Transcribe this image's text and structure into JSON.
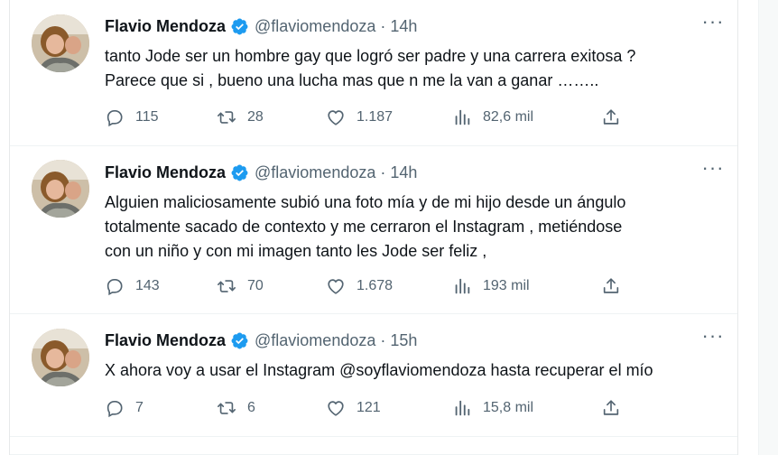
{
  "tweets": [
    {
      "name": "Flavio Mendoza",
      "handle": "@flaviomendoza",
      "separator": "·",
      "time": "14h",
      "more": "···",
      "text_lines": [
        "tanto Jode ser un hombre gay que logró ser padre y una carrera exitosa ?",
        "Parece que si , bueno una lucha mas que n me la van a ganar ……..",
        ""
      ],
      "replies": "115",
      "retweets": "28",
      "likes": "1.187",
      "views": "82,6 mil"
    },
    {
      "name": "Flavio Mendoza",
      "handle": "@flaviomendoza",
      "separator": "·",
      "time": "14h",
      "more": "···",
      "text_lines": [
        "Alguien maliciosamente subió una foto mía y de mi hijo desde un ángulo",
        "totalmente sacado de contexto y me cerraron el Instagram , metiéndose",
        "con un niño y con mi imagen tanto les Jode ser feliz ,"
      ],
      "replies": "143",
      "retweets": "70",
      "likes": "1.678",
      "views": "193 mil"
    },
    {
      "name": "Flavio Mendoza",
      "handle": "@flaviomendoza",
      "separator": "·",
      "time": "15h",
      "more": "···",
      "text_lines": [
        "X ahora voy a usar el Instagram @soyflaviomendoza hasta recuperar el mío",
        "",
        ""
      ],
      "replies": "7",
      "retweets": "6",
      "likes": "121",
      "views": "15,8 mil"
    }
  ],
  "icons": {
    "verified": "verified-badge-icon",
    "reply": "reply-icon",
    "retweet": "retweet-icon",
    "like": "heart-icon",
    "views": "views-chart-icon",
    "share": "share-icon",
    "more": "more-options-icon"
  },
  "colors": {
    "verified": "#1d9bf0",
    "secondary_text": "#536471",
    "primary_text": "#0f1419",
    "divider": "#eff3f4"
  }
}
